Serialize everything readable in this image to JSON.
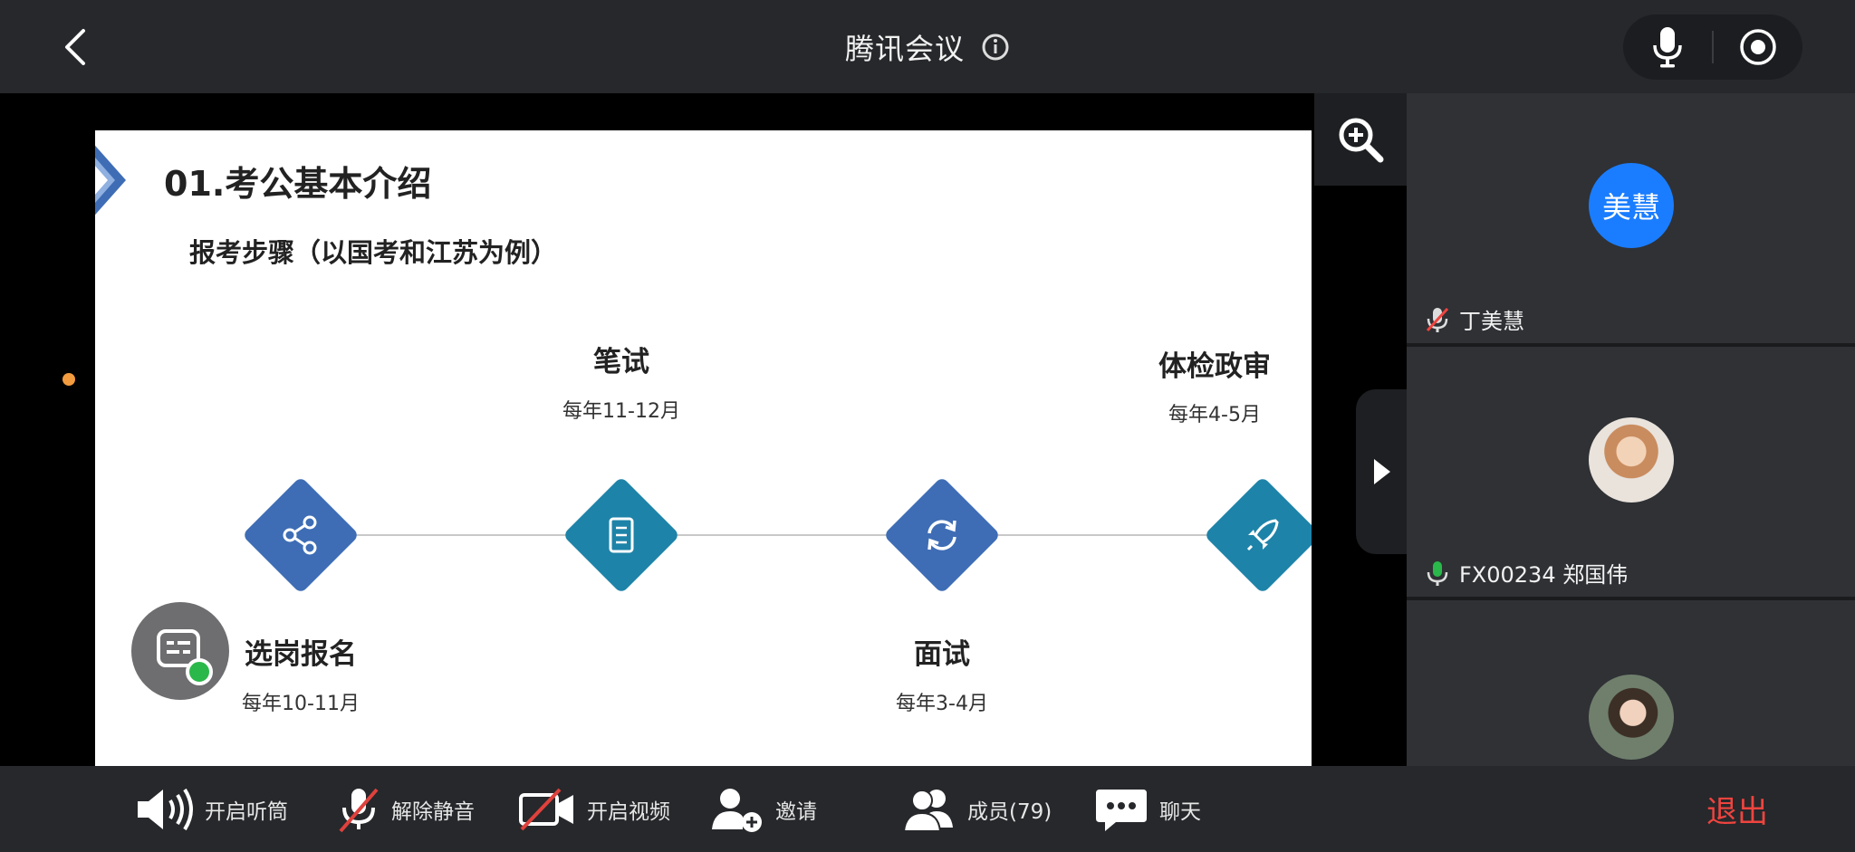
{
  "app": {
    "title": "腾讯会议",
    "exit_label": "退出"
  },
  "slide": {
    "heading": "01.考公基本介绍",
    "subheading": "报考步骤（以国考和江苏为例）",
    "steps": [
      {
        "name": "选岗报名",
        "date": "每年10-11月",
        "icon": "share-icon",
        "color": "#3e6db5"
      },
      {
        "name": "笔试",
        "date": "每年11-12月",
        "icon": "document-icon",
        "color": "#1e83a8"
      },
      {
        "name": "面试",
        "date": "每年3-4月",
        "icon": "refresh-icon",
        "color": "#3e6db5"
      },
      {
        "name": "体检政审",
        "date": "每年4-5月",
        "icon": "rocket-icon",
        "color": "#1e83a8"
      }
    ]
  },
  "participants": [
    {
      "avatar_text": "美慧",
      "name": "丁美慧",
      "mic": "muted"
    },
    {
      "avatar_text": "",
      "name": "FX00234 郑国伟",
      "mic": "active"
    },
    {
      "avatar_text": "",
      "name": "",
      "mic": ""
    }
  ],
  "toolbar": {
    "speaker": "开启听筒",
    "unmute": "解除静音",
    "video": "开启视频",
    "invite": "邀请",
    "members": "成员(79)",
    "chat": "聊天"
  },
  "colors": {
    "accent_blue": "#1a7dff",
    "exit_red": "#f0443f",
    "mic_green": "#2ab84a"
  }
}
